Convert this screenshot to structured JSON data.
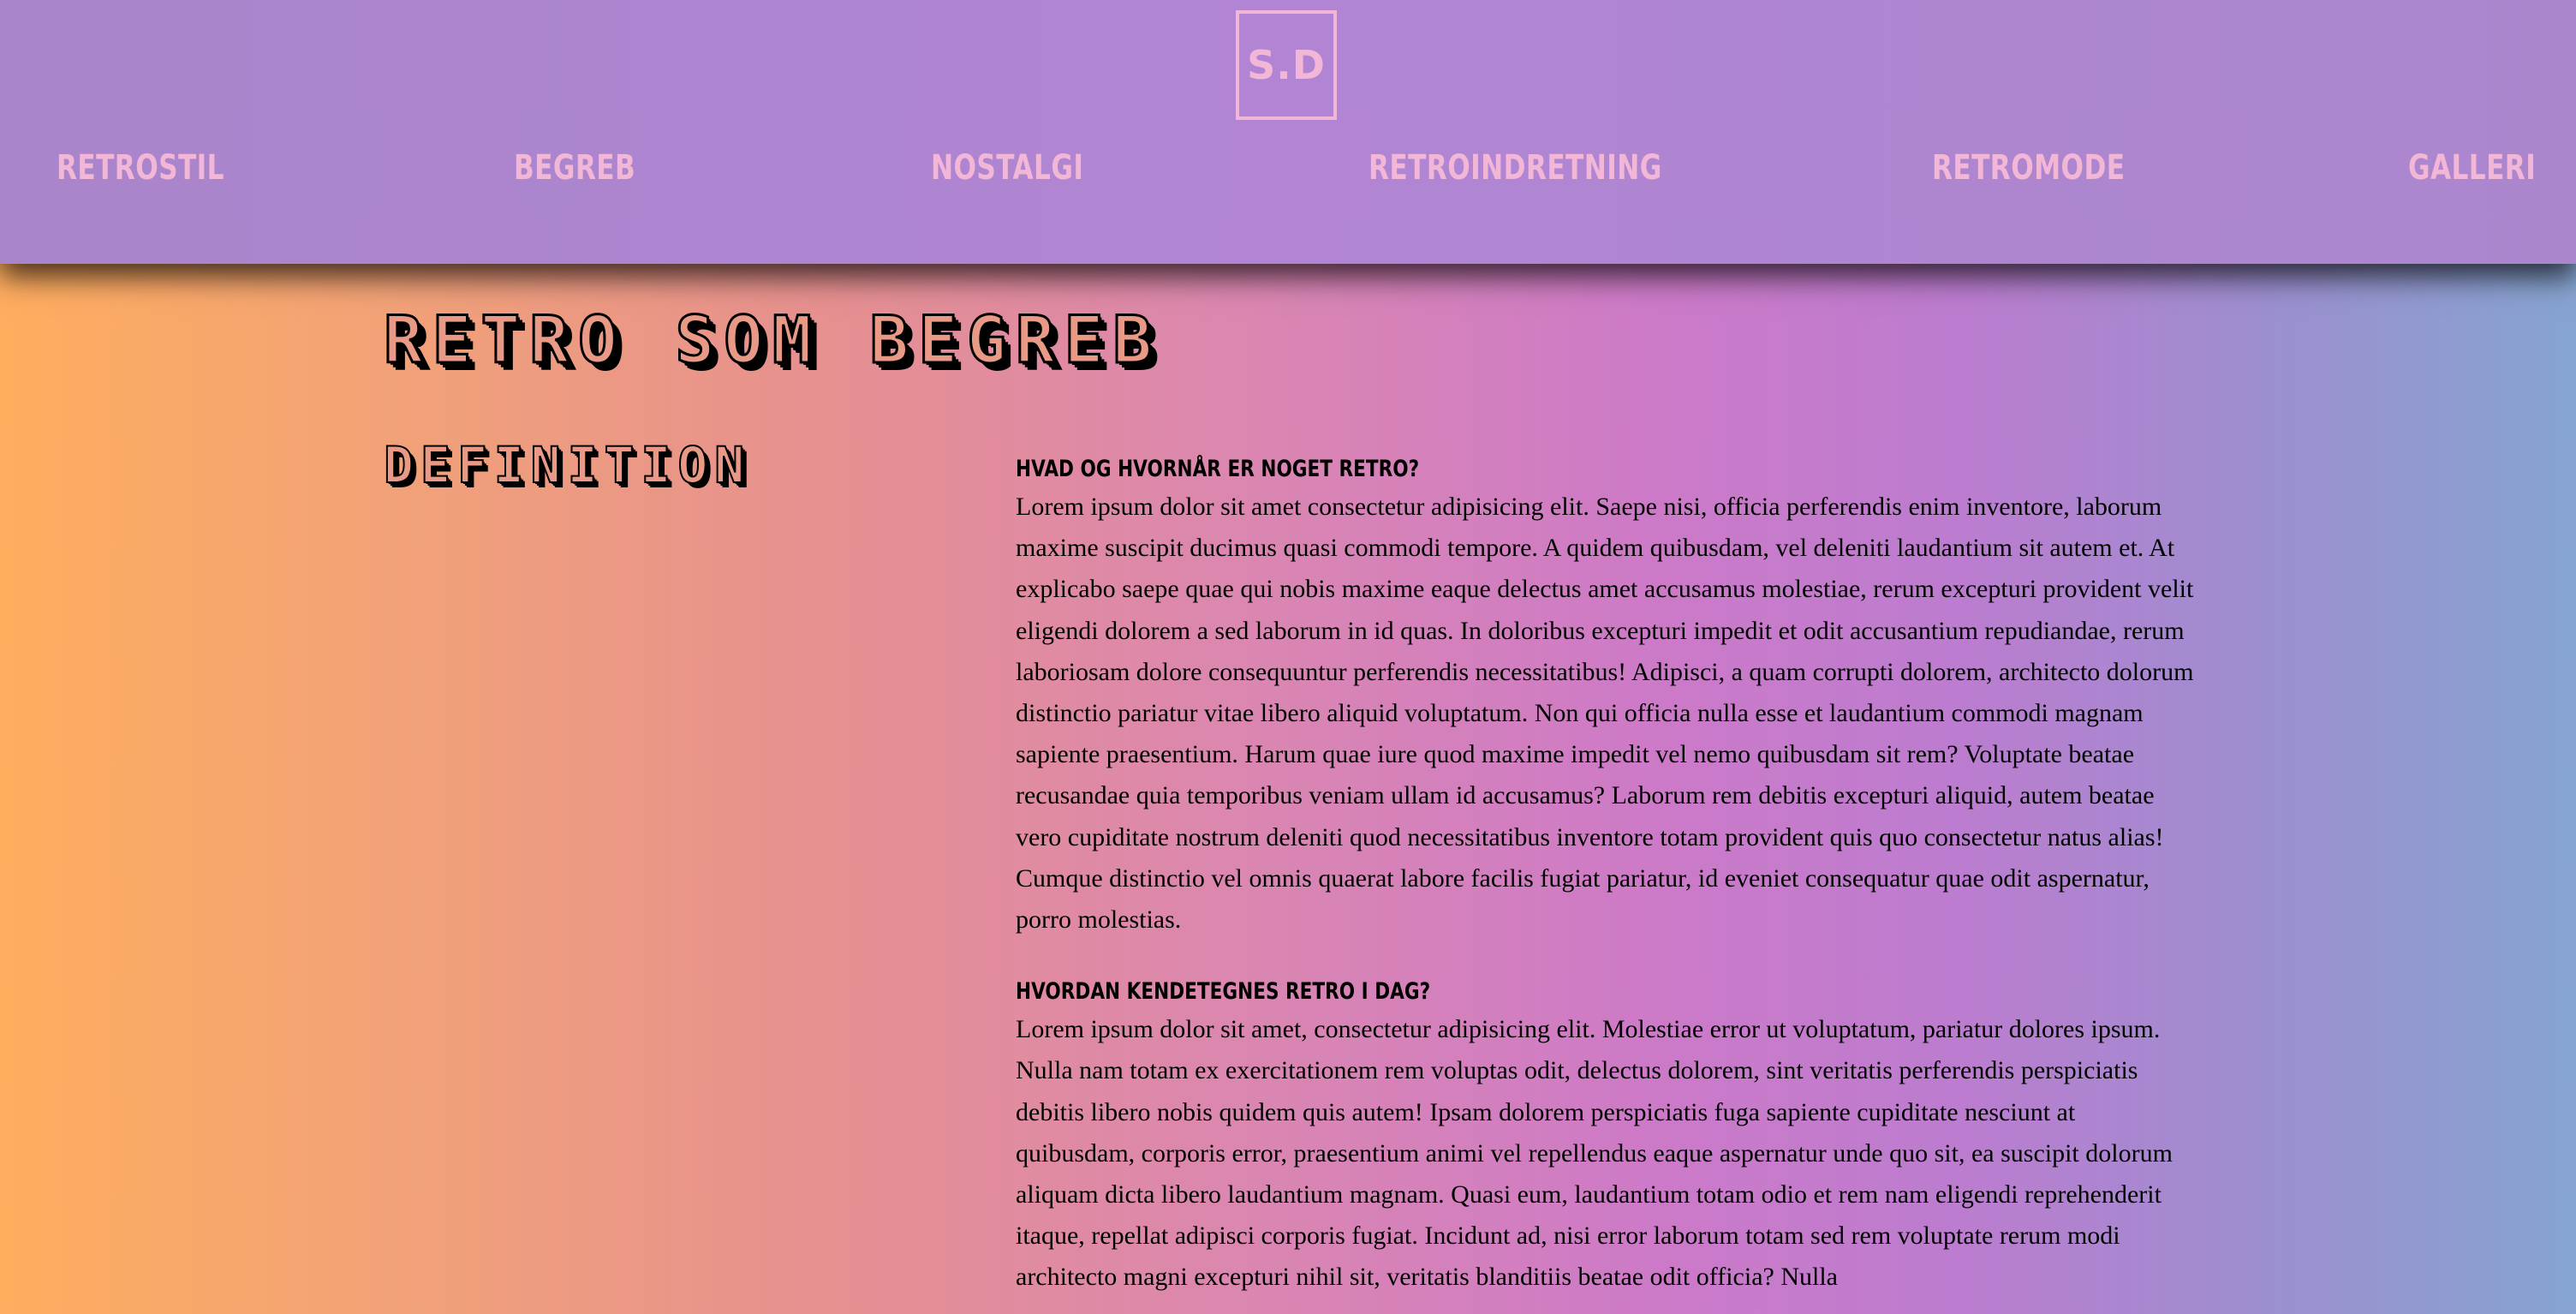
{
  "logo": {
    "text": "S.D"
  },
  "nav": {
    "items": [
      {
        "label": "RETROSTIL"
      },
      {
        "label": "BEGREB"
      },
      {
        "label": "NOSTALGI"
      },
      {
        "label": "RETROINDRETNING"
      },
      {
        "label": "RETROMODE"
      },
      {
        "label": "GALLERI"
      }
    ]
  },
  "page": {
    "title": "RETRO SOM BEGREB",
    "section_title": "DEFINITION"
  },
  "content": {
    "sections": [
      {
        "heading": "HVAD OG HVORNÅR ER NOGET RETRO?",
        "body": "Lorem ipsum dolor sit amet consectetur adipisicing elit. Saepe nisi, officia perferendis enim inventore, laborum maxime suscipit ducimus quasi commodi tempore. A quidem quibusdam, vel deleniti laudantium sit autem et. At explicabo saepe quae qui nobis maxime eaque delectus amet accusamus molestiae, rerum excepturi provident velit eligendi dolorem a sed laborum in id quas. In doloribus excepturi impedit et odit accusantium repudiandae, rerum laboriosam dolore consequuntur perferendis necessitatibus! Adipisci, a quam corrupti dolorem, architecto dolorum distinctio pariatur vitae libero aliquid voluptatum. Non qui officia nulla esse et laudantium commodi magnam sapiente praesentium. Harum quae iure quod maxime impedit vel nemo quibusdam sit rem? Voluptate beatae recusandae quia temporibus veniam ullam id accusamus? Laborum rem debitis excepturi aliquid, autem beatae vero cupiditate nostrum deleniti quod necessitatibus inventore totam provident quis quo consectetur natus alias! Cumque distinctio vel omnis quaerat labore facilis fugiat pariatur, id eveniet consequatur quae odit aspernatur, porro molestias."
      },
      {
        "heading": "HVORDAN KENDETEGNES RETRO I DAG?",
        "body": "Lorem ipsum dolor sit amet, consectetur adipisicing elit. Molestiae error ut voluptatum, pariatur dolores ipsum. Nulla nam totam ex exercitationem rem voluptas odit, delectus dolorem, sint veritatis perferendis perspiciatis debitis libero nobis quidem quis autem! Ipsam dolorem perspiciatis fuga sapiente cupiditate nesciunt at quibusdam, corporis error, praesentium animi vel repellendus eaque aspernatur unde quo sit, ea suscipit dolorum aliquam dicta libero laudantium magnam. Quasi eum, laudantium totam odio et rem nam eligendi reprehenderit itaque, repellat adipisci corporis fugiat. Incidunt ad, nisi error laborum totam sed rem voluptate rerum modi architecto magni excepturi nihil sit, veritatis blanditiis beatae odit officia? Nulla"
      }
    ]
  },
  "colors": {
    "header_bg": "#af85d1",
    "nav_text": "#f2b6d6",
    "title_fill": "#e99a86",
    "gradient_left": "#ffad5e",
    "gradient_mid": "#cd7ac8",
    "gradient_right": "#86a4d0"
  }
}
